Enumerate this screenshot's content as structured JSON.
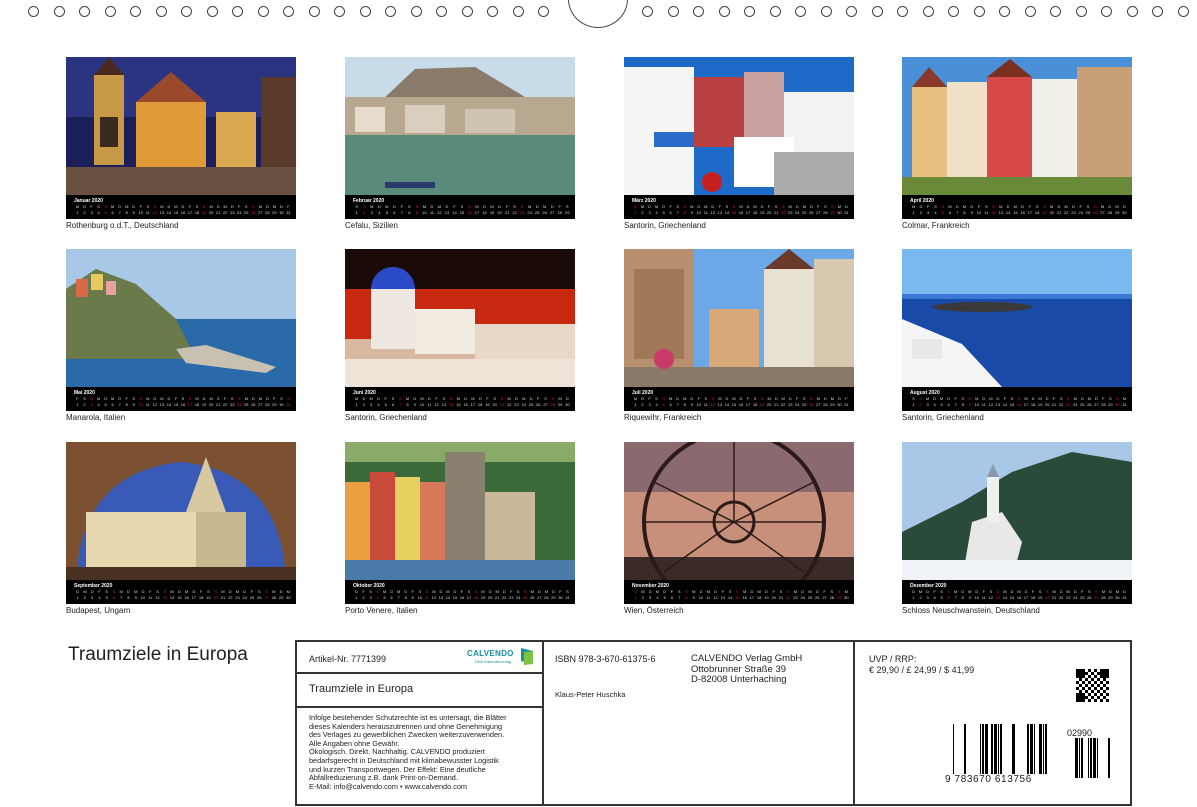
{
  "calendar_title": "Traumziele in Europa",
  "months": [
    {
      "name": "Januar 2020",
      "caption": "Rothenburg o.d.T., Deutschland",
      "days": 31,
      "sundays": [
        5,
        12,
        19,
        26
      ]
    },
    {
      "name": "Februar 2020",
      "caption": "Cefalu, Sizilien",
      "days": 29,
      "sundays": [
        2,
        9,
        16,
        23
      ]
    },
    {
      "name": "März 2020",
      "caption": "Santorin, Griechenland",
      "days": 31,
      "sundays": [
        1,
        8,
        15,
        22,
        29
      ]
    },
    {
      "name": "April 2020",
      "caption": "Colmar, Frankreich",
      "days": 30,
      "sundays": [
        5,
        12,
        19,
        26
      ]
    },
    {
      "name": "Mai 2020",
      "caption": "Manarola, Italien",
      "days": 31,
      "sundays": [
        3,
        10,
        17,
        24,
        31
      ]
    },
    {
      "name": "Juni 2020",
      "caption": "Santorin, Griechenland",
      "days": 30,
      "sundays": [
        7,
        14,
        21,
        28
      ]
    },
    {
      "name": "Juli 2020",
      "caption": "Riquewihr, Frankreich",
      "days": 31,
      "sundays": [
        5,
        12,
        19,
        26
      ]
    },
    {
      "name": "August 2020",
      "caption": "Santorin, Griechenland",
      "days": 31,
      "sundays": [
        2,
        9,
        16,
        23,
        30
      ]
    },
    {
      "name": "September 2020",
      "caption": "Budapest, Ungarn",
      "days": 30,
      "sundays": [
        6,
        13,
        20,
        27
      ]
    },
    {
      "name": "Oktober 2020",
      "caption": "Porto Venere, Italien",
      "days": 31,
      "sundays": [
        4,
        11,
        18,
        25
      ]
    },
    {
      "name": "November 2020",
      "caption": "Wien, Österreich",
      "days": 30,
      "sundays": [
        1,
        8,
        15,
        22,
        29
      ]
    },
    {
      "name": "Dezember 2020",
      "caption": "Schloss Neuschwanstein, Deutschland",
      "days": 31,
      "sundays": [
        6,
        13,
        20,
        27
      ]
    }
  ],
  "info": {
    "article": "Artikel-Nr. 7771399",
    "logo_text": "CALVENDO",
    "logo_sub": "Dein Kalenderverlag",
    "product_title": "Traumziele in Europa",
    "legal_lines": [
      "Infolge bestehender Schutzrechte ist es untersagt, die Blätter",
      "dieses Kalenders herauszutrennen und ohne Genehmigung",
      "des Verlages zu gewerblichen Zwecken weiterzuverwenden.",
      "Alle Angaben ohne Gewähr.",
      "Ökologisch. Direkt. Nachhaltig. CALVENDO produziert",
      "bedarfsgerecht in Deutschland mit klimabewusster Logistik",
      "und kurzen Transportwegen. Der Effekt: Eine deutliche",
      "Abfallreduzierung z.B. dank Print-on-Demand.",
      "E-Mail: info@calvendo.com • www.calvendo.com"
    ],
    "isbn": "ISBN 978-3-670-61375-6",
    "author": "Klaus-Peter Huschka",
    "publisher_lines": [
      "CALVENDO Verlag GmbH",
      "Ottobrunner Straße 39",
      "D-82008 Unterhaching"
    ],
    "price_label": "UVP / RRP:",
    "price_value": "€ 29,90 / £ 24,99 / $ 41,99",
    "barcode_digits": "9 783670 613756",
    "barcode_addon": "02990"
  },
  "colors": {
    "sunday": "#e02020",
    "calendar_bar": "#000000",
    "accent": "#1a8fa0"
  }
}
